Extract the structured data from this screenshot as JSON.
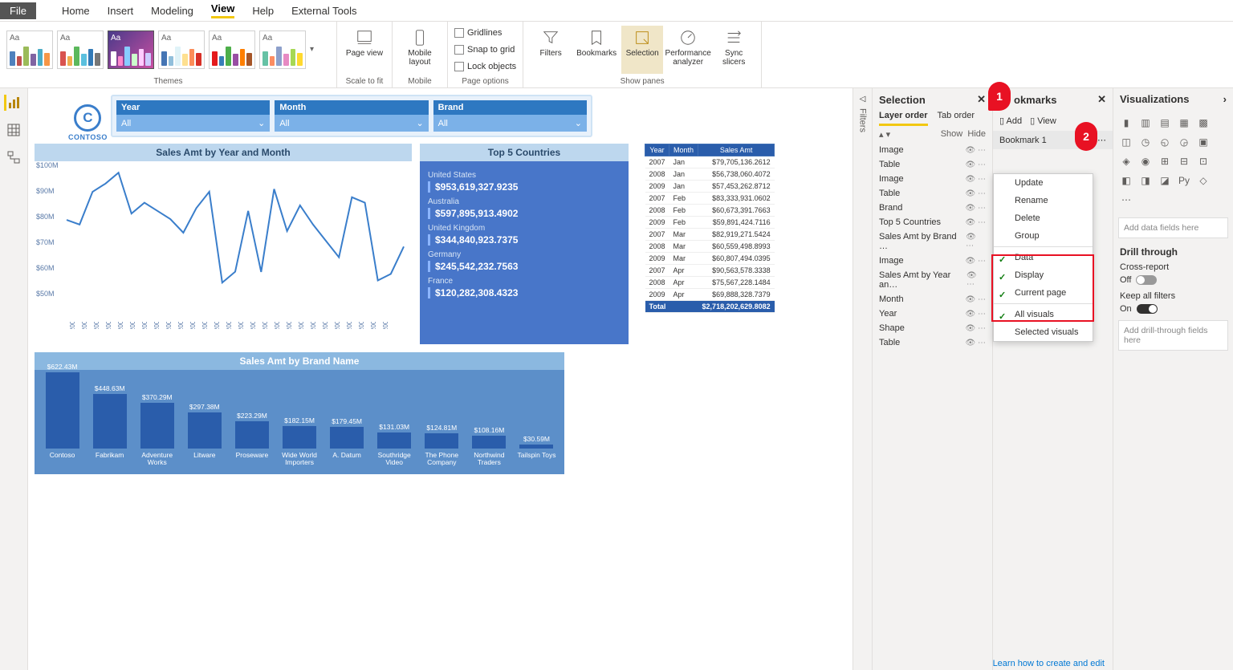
{
  "menu": {
    "file": "File",
    "items": [
      "Home",
      "Insert",
      "Modeling",
      "View",
      "Help",
      "External Tools"
    ],
    "activeIndex": 3
  },
  "ribbon": {
    "themes_label": "Themes",
    "scale_label": "Scale to fit",
    "mobile_label": "Mobile",
    "pageopt_label": "Page options",
    "panes_label": "Show panes",
    "page_view": "Page view",
    "mobile_layout": "Mobile layout",
    "gridlines": "Gridlines",
    "snap": "Snap to grid",
    "lock": "Lock objects",
    "filters": "Filters",
    "bookmarks": "Bookmarks",
    "selection": "Selection",
    "perf": "Performance analyzer",
    "sync": "Sync slicers"
  },
  "logo": "CONTOSO",
  "slicers": [
    {
      "label": "Year",
      "value": "All"
    },
    {
      "label": "Month",
      "value": "All"
    },
    {
      "label": "Brand",
      "value": "All"
    }
  ],
  "chart_data": [
    {
      "type": "line",
      "title": "Sales Amt by Year and Month",
      "ylabel": "",
      "ylim": [
        50,
        100
      ],
      "yticks": [
        "$100M",
        "$90M",
        "$80M",
        "$70M",
        "$60M",
        "$50M"
      ],
      "categories": [
        "2007 Jan",
        "2007 Feb",
        "2007 Mar",
        "2007 Apr",
        "2007 May",
        "2007 Jun",
        "2007 Jul",
        "2007 Aug",
        "2007 Sep",
        "2007 Oct",
        "2007 Nov",
        "2007 Dec",
        "2008 Jan",
        "2008 Feb",
        "2008 Mar",
        "2008 Apr",
        "2008 May",
        "2008 Jun",
        "2008 Jul",
        "2008 Aug",
        "2008 Sep",
        "2008 Oct",
        "2008 Nov",
        "2008 Dec",
        "2009 Jan",
        "2009 Feb",
        "2009 Mar"
      ],
      "values": [
        79.7,
        78,
        90,
        93,
        97,
        82,
        86,
        83,
        80,
        75,
        84,
        90,
        56.7,
        60.7,
        83,
        60.6,
        91,
        75.6,
        85,
        78,
        72,
        66,
        88,
        86,
        57.5,
        59.9,
        69.9
      ]
    },
    {
      "type": "bar",
      "title": "Sales Amt by Brand Name",
      "categories": [
        "Contoso",
        "Fabrikam",
        "Adventure Works",
        "Litware",
        "Proseware",
        "Wide World Importers",
        "A. Datum",
        "Southridge Video",
        "The Phone Company",
        "Northwind Traders",
        "Tailspin Toys"
      ],
      "labels": [
        "$622.43M",
        "$448.63M",
        "$370.29M",
        "$297.38M",
        "$223.29M",
        "$182.15M",
        "$179.45M",
        "$131.03M",
        "$124.81M",
        "$108.16M",
        "$30.59M"
      ],
      "values": [
        622.43,
        448.63,
        370.29,
        297.38,
        223.29,
        182.15,
        179.45,
        131.03,
        124.81,
        108.16,
        30.59
      ]
    }
  ],
  "top5": {
    "title": "Top 5 Countries",
    "rows": [
      {
        "c": "United States",
        "v": "$953,619,327.9235"
      },
      {
        "c": "Australia",
        "v": "$597,895,913.4902"
      },
      {
        "c": "United Kingdom",
        "v": "$344,840,923.7375"
      },
      {
        "c": "Germany",
        "v": "$245,542,232.7563"
      },
      {
        "c": "France",
        "v": "$120,282,308.4323"
      }
    ]
  },
  "table": {
    "headers": [
      "Year",
      "Month",
      "Sales Amt"
    ],
    "rows": [
      [
        "2007",
        "Jan",
        "$79,705,136.2612"
      ],
      [
        "2008",
        "Jan",
        "$56,738,060.4072"
      ],
      [
        "2009",
        "Jan",
        "$57,453,262.8712"
      ],
      [
        "2007",
        "Feb",
        "$83,333,931.0602"
      ],
      [
        "2008",
        "Feb",
        "$60,673,391.7663"
      ],
      [
        "2009",
        "Feb",
        "$59,891,424.7116"
      ],
      [
        "2007",
        "Mar",
        "$82,919,271.5424"
      ],
      [
        "2008",
        "Mar",
        "$60,559,498.8993"
      ],
      [
        "2009",
        "Mar",
        "$60,807,494.0395"
      ],
      [
        "2007",
        "Apr",
        "$90,563,578.3338"
      ],
      [
        "2008",
        "Apr",
        "$75,567,228.1484"
      ],
      [
        "2009",
        "Apr",
        "$69,888,328.7379"
      ]
    ],
    "total_label": "Total",
    "total_value": "$2,718,202,629.8082"
  },
  "selection": {
    "title": "Selection",
    "tabs": [
      "Layer order",
      "Tab order"
    ],
    "show": "Show",
    "hide": "Hide",
    "items": [
      "Image",
      "Table",
      "Image",
      "Table",
      "Brand",
      "Top 5 Countries",
      "Sales Amt by Brand …",
      "Image",
      "Sales Amt by Year an…",
      "Month",
      "Year",
      "Shape",
      "Table"
    ]
  },
  "bookmarks": {
    "title": "okmarks",
    "add": "Add",
    "view": "View",
    "item": "Bookmark 1",
    "menu": {
      "a": "Update",
      "b": "Rename",
      "c": "Delete",
      "d": "Group",
      "e": "Data",
      "f": "Display",
      "g": "Current page",
      "h": "All visuals",
      "i": "Selected visuals"
    }
  },
  "viz": {
    "title": "Visualizations",
    "fields_placeholder": "Add data fields here",
    "drill": "Drill through",
    "cross": "Cross-report",
    "off": "Off",
    "keep": "Keep all filters",
    "on": "On",
    "drill_placeholder": "Add drill-through fields here"
  },
  "callouts": {
    "one": "1",
    "two": "2"
  },
  "filters_label": "Filters",
  "footer": "Learn how to create and edit"
}
